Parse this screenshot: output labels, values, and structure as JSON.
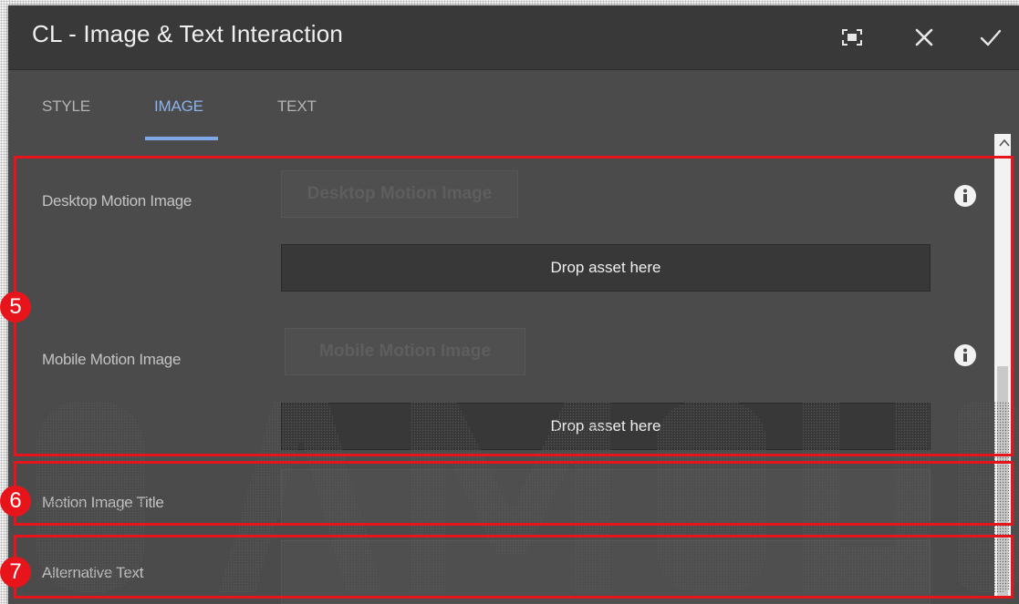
{
  "dialog": {
    "title": "CL - Image & Text Interaction",
    "actions": {
      "fullscreen_icon": "fullscreen-icon",
      "close_icon": "close-icon",
      "done_icon": "checkmark-icon"
    }
  },
  "tabs": [
    {
      "label": "STYLE",
      "active": false
    },
    {
      "label": "IMAGE",
      "active": true
    },
    {
      "label": "TEXT",
      "active": false
    }
  ],
  "fields": {
    "desktop_motion_image": {
      "label": "Desktop Motion Image",
      "button_label": "Desktop Motion Image",
      "drop_label": "Drop asset here"
    },
    "mobile_motion_image": {
      "label": "Mobile Motion Image",
      "button_label": "Mobile Motion Image",
      "drop_label": "Drop asset here"
    },
    "motion_image_title": {
      "label": "Motion Image Title",
      "value": ""
    },
    "alternative_text": {
      "label": "Alternative Text",
      "value": ""
    }
  },
  "annotations": [
    {
      "number": "5"
    },
    {
      "number": "6"
    },
    {
      "number": "7"
    }
  ],
  "colors": {
    "dialog_bg": "#4b4b4b",
    "titlebar_bg": "#393939",
    "active_tab": "#8db3ec",
    "annotation_red": "#e8141b"
  }
}
